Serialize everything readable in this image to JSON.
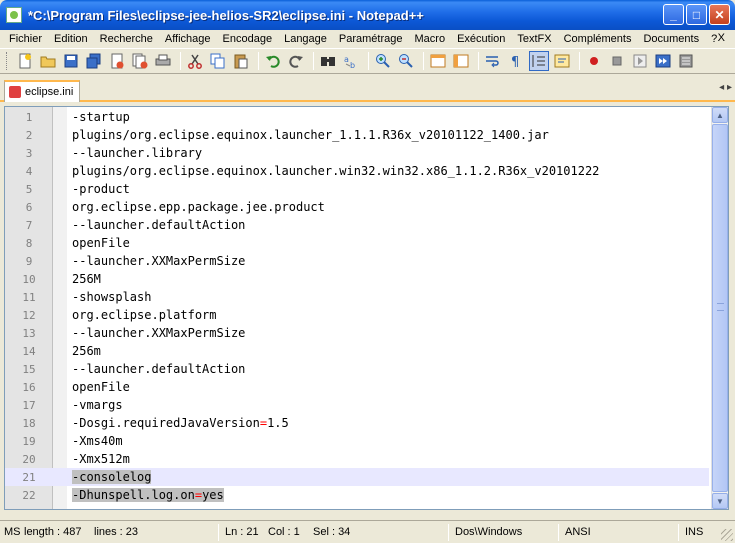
{
  "window": {
    "title": "*C:\\Program Files\\eclipse-jee-helios-SR2\\eclipse.ini - Notepad++",
    "minimize": "_",
    "maximize": "□",
    "close": "✕"
  },
  "menu": {
    "items": [
      "Fichier",
      "Edition",
      "Recherche",
      "Affichage",
      "Encodage",
      "Langage",
      "Paramétrage",
      "Macro",
      "Exécution",
      "TextFX",
      "Compléments",
      "Documents",
      "?"
    ],
    "close": "X"
  },
  "toolbar": {
    "icons": [
      "new-file-icon",
      "open-file-icon",
      "save-icon",
      "save-all-icon",
      "close-icon",
      "close-all-icon",
      "print-icon",
      "cut-icon",
      "copy-icon",
      "paste-icon",
      "undo-icon",
      "redo-icon",
      "find-icon",
      "replace-icon",
      "zoom-in-icon",
      "zoom-out-icon",
      "sync-v-icon",
      "sync-h-icon",
      "word-wrap-icon",
      "show-all-chars-icon",
      "indent-guide-icon",
      "user-lang-icon",
      "record-macro-icon",
      "stop-macro-icon",
      "play-macro-icon",
      "run-macro-multiple-icon",
      "save-macro-icon"
    ]
  },
  "tab": {
    "label": "eclipse.ini"
  },
  "editor": {
    "lines": [
      "-startup",
      "plugins/org.eclipse.equinox.launcher_1.1.1.R36x_v20101122_1400.jar",
      "--launcher.library",
      "plugins/org.eclipse.equinox.launcher.win32.win32.x86_1.1.2.R36x_v20101222",
      "-product",
      "org.eclipse.epp.package.jee.product",
      "--launcher.defaultAction",
      "openFile",
      "--launcher.XXMaxPermSize",
      "256M",
      "-showsplash",
      "org.eclipse.platform",
      "--launcher.XXMaxPermSize",
      "256m",
      "--launcher.defaultAction",
      "openFile",
      "-vmargs",
      "-Dosgi.requiredJavaVersion=1.5",
      "-Xms40m",
      "-Xmx512m",
      "-consolelog",
      "-Dhunspell.log.on=yes"
    ],
    "current_line": 21
  },
  "status": {
    "ms": "MS",
    "length": "length : 487",
    "lines": "lines : 23",
    "ln": "Ln : 21",
    "col": "Col : 1",
    "sel": "Sel : 34",
    "eol": "Dos\\Windows",
    "encoding": "ANSI",
    "mode": "INS"
  },
  "colors": {
    "titlebar": "#0a5fd8",
    "current_line": "#e8e8ff",
    "selection": "#c0c0c0",
    "operator": "#ff0000",
    "tab_accent": "#ffb84d"
  }
}
